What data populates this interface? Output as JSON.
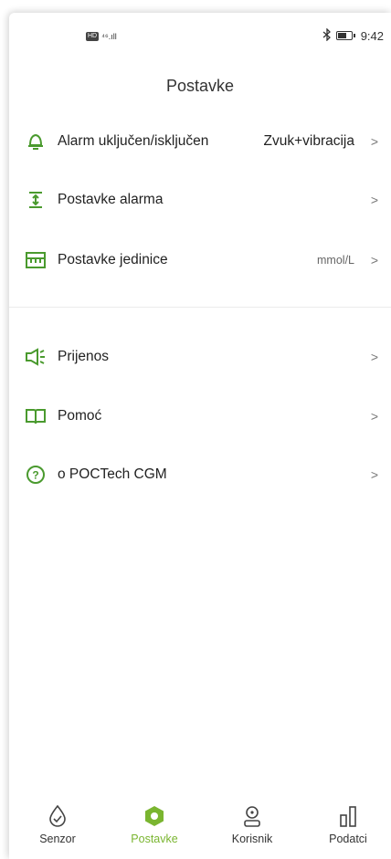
{
  "status_bar": {
    "network": "⁴⁶.ıll",
    "hd": "HD",
    "time": "9:42",
    "bluetooth": "bluetooth-icon"
  },
  "page": {
    "title": "Postavke"
  },
  "settings": [
    {
      "icon": "bell-icon",
      "label": "Alarm uključen/isključen",
      "value": "Zvuk+vibracija"
    },
    {
      "icon": "alarm-range-icon",
      "label": "Postavke alarma",
      "value": ""
    },
    {
      "icon": "ruler-icon",
      "label": "Postavke jedinice",
      "value": "mmol/L"
    }
  ],
  "more": [
    {
      "icon": "speaker-icon",
      "label": "Prijenos"
    },
    {
      "icon": "book-icon",
      "label": "Pomoć"
    },
    {
      "icon": "question-icon",
      "label": "o POCTech CGM"
    }
  ],
  "tabs": [
    {
      "icon": "drop-icon",
      "label": "Senzor"
    },
    {
      "icon": "gear-icon",
      "label": "Postavke",
      "active": true
    },
    {
      "icon": "user-icon",
      "label": "Korisnik"
    },
    {
      "icon": "bars-icon",
      "label": "Podatci"
    }
  ],
  "colors": {
    "accent": "#7ab530",
    "icon_green": "#4a9a2e"
  }
}
